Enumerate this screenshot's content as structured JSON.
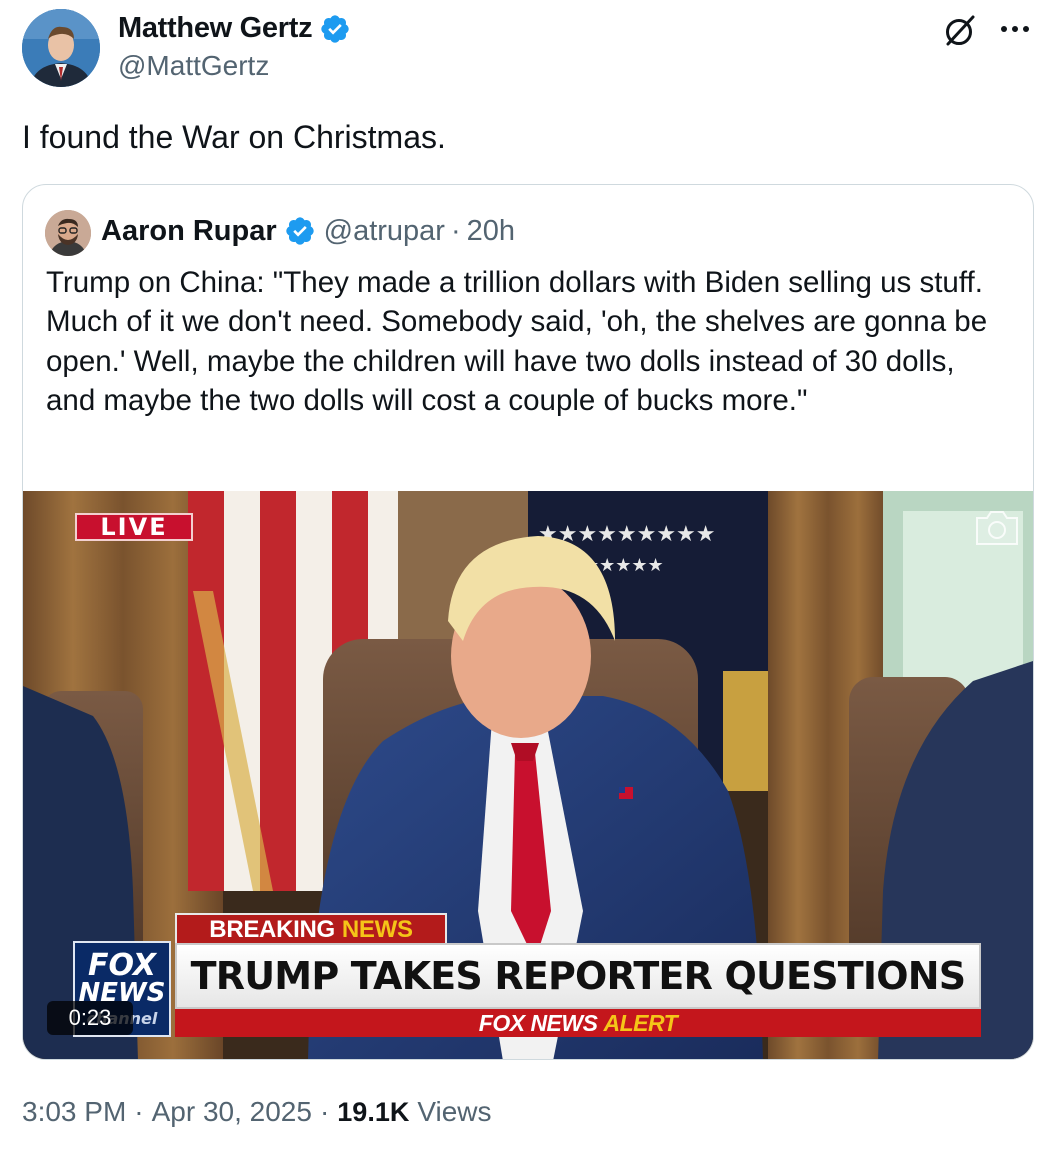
{
  "tweet": {
    "author": {
      "name": "Matthew Gertz",
      "handle": "@MattGertz",
      "verified": true
    },
    "text": "I found the War on Christmas.",
    "quoted": {
      "author": {
        "name": "Aaron Rupar",
        "handle": "@atrupar",
        "verified": true
      },
      "separator": "·",
      "time": "20h",
      "text": "Trump on China: \"They made a trillion dollars with Biden selling us stuff. Much of it we don't need. Somebody said, 'oh, the shelves are gonna be open.' Well, maybe the children will have two dolls instead of 30 dolls, and maybe the two dolls will cost a couple of bucks more.\"",
      "video": {
        "live_badge": "LIVE",
        "breaking_label": "BREAKING",
        "breaking_news_word": "NEWS",
        "headline": "TRUMP TAKES REPORTER QUESTIONS",
        "alert_brand": "FOX NEWS",
        "alert_word": "ALERT",
        "logo_line1": "FOX",
        "logo_line2": "NEWS",
        "logo_line3": "channel",
        "duration": "0:23"
      }
    },
    "meta": {
      "time": "3:03 PM",
      "separator": "·",
      "date": "Apr 30, 2025",
      "views_count": "19.1K",
      "views_label": "Views"
    }
  },
  "icons": {
    "verified": "verified-badge-icon",
    "grok": "grok-icon",
    "more": "more-icon",
    "camera": "camera-icon"
  },
  "colors": {
    "verified_blue": "#1d9bf0",
    "text_primary": "#0f1419",
    "text_secondary": "#536471",
    "border": "#cfd9de"
  }
}
